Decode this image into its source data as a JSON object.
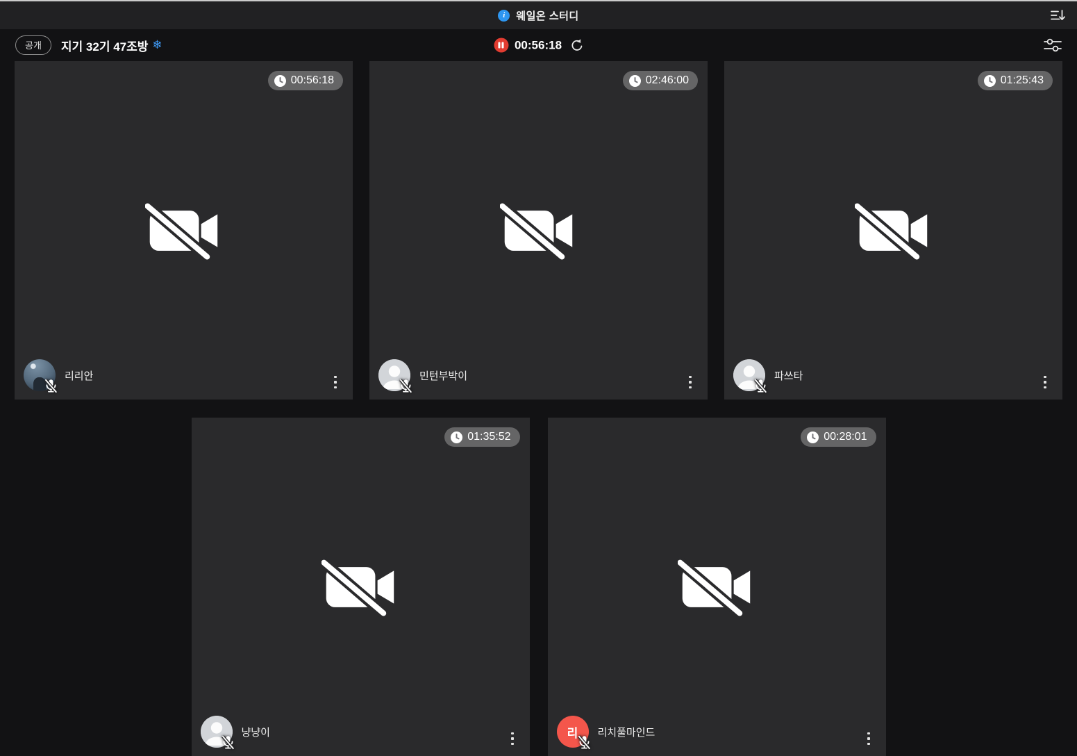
{
  "titlebar": {
    "title": "웨일온 스터디",
    "info_icon": "info-icon",
    "sort_icon": "sort-descending-icon"
  },
  "toolbar": {
    "visibility_badge": "공개",
    "room_title": "지기 32기 47조방",
    "room_emoji": "❄",
    "session_timer": "00:56:18",
    "pause_icon": "pause-icon",
    "reset_icon": "reset-timer-icon",
    "filter_icon": "filter-sliders-icon"
  },
  "colors": {
    "page_bg": "#121214",
    "titlebar_bg": "#212123",
    "tile_bg": "#2a2a2c",
    "accent_blue": "#2e96f0",
    "snowflake_blue": "#3f9af5",
    "pause_red": "#e23c31",
    "timer_badge_bg": "rgba(255,255,255,0.28)",
    "initial_avatar_bg": "#f4564b"
  },
  "participants": [
    {
      "name": "리리안",
      "timer": "00:56:18",
      "avatar_type": "photo",
      "muted": true,
      "camera_off": true
    },
    {
      "name": "민턴부박이",
      "timer": "02:46:00",
      "avatar_type": "default",
      "muted": true,
      "camera_off": true
    },
    {
      "name": "파쓰타",
      "timer": "01:25:43",
      "avatar_type": "default",
      "muted": true,
      "camera_off": true
    },
    {
      "name": "냥냥이",
      "timer": "01:35:52",
      "avatar_type": "default",
      "muted": true,
      "camera_off": true
    },
    {
      "name": "리치풀마인드",
      "timer": "00:28:01",
      "avatar_type": "initial",
      "avatar_initial": "리",
      "avatar_color": "#f4564b",
      "muted": true,
      "camera_off": true
    }
  ],
  "grid_rows": [
    [
      0,
      1,
      2
    ],
    [
      3,
      4
    ]
  ]
}
